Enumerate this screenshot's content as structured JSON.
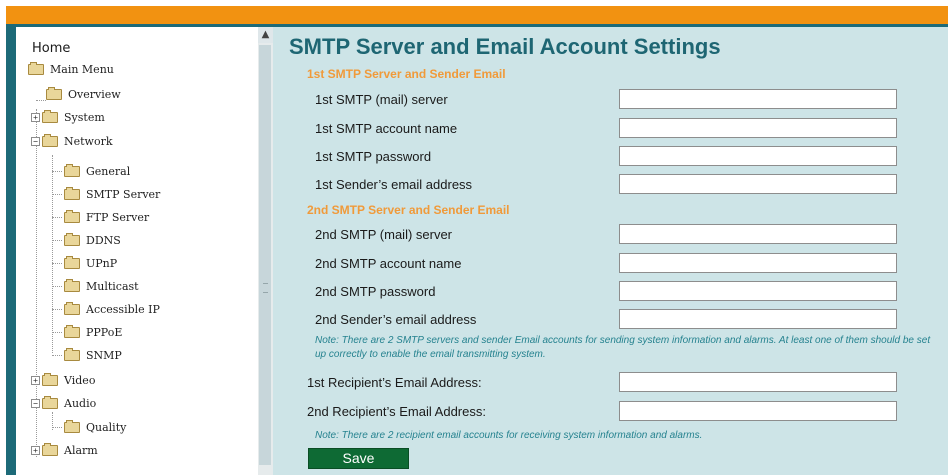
{
  "sidebar": {
    "home": "Home",
    "main_menu": "Main Menu",
    "overview": "Overview",
    "system": "System",
    "network": "Network",
    "network_items": [
      "General",
      "SMTP Server",
      "FTP Server",
      "DDNS",
      "UPnP",
      "Multicast",
      "Accessible IP",
      "PPPoE",
      "SNMP"
    ],
    "video": "Video",
    "audio": "Audio",
    "quality": "Quality",
    "alarm": "Alarm"
  },
  "main": {
    "title": "SMTP Server and Email Account Settings",
    "section1": "1st SMTP Server and Sender Email",
    "section1_fields": [
      {
        "label": "1st SMTP (mail) server",
        "value": ""
      },
      {
        "label": "1st SMTP account name",
        "value": ""
      },
      {
        "label": "1st SMTP password",
        "value": ""
      },
      {
        "label": "1st Sender’s email address",
        "value": ""
      }
    ],
    "section2": "2nd SMTP Server and Sender Email",
    "section2_fields": [
      {
        "label": "2nd SMTP (mail) server",
        "value": ""
      },
      {
        "label": "2nd SMTP account name",
        "value": ""
      },
      {
        "label": "2nd SMTP password",
        "value": ""
      },
      {
        "label": "2nd Sender’s email address",
        "value": ""
      }
    ],
    "note1": "Note: There are 2 SMTP servers and sender Email accounts for sending system information and alarms. At least one of them should be set up correctly to enable the email transmitting system.",
    "recipients": [
      {
        "label": "1st Recipient’s Email Address:",
        "value": ""
      },
      {
        "label": "2nd Recipient’s Email Address:",
        "value": ""
      }
    ],
    "note2": "Note: There are 2 recipient email accounts for receiving system information and alarms.",
    "save_label": "Save"
  },
  "colors": {
    "accent_bar": "#f29211",
    "frame": "#1d6a78",
    "title": "#1e6673",
    "section": "#f09a3a",
    "note": "#25828f",
    "save_button": "#0e6a34"
  },
  "icons": [
    "folder-icon",
    "expand-plus-icon",
    "collapse-minus-icon",
    "scroll-up-arrow-icon"
  ]
}
